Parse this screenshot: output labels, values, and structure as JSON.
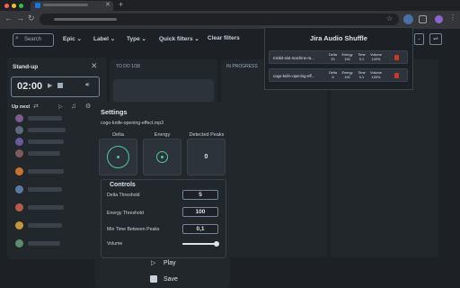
{
  "browser": {
    "new_tab_symbol": "+"
  },
  "toolbar": {
    "search_placeholder": "Search",
    "filters": [
      "Epic",
      "Label",
      "Type",
      "Quick filters"
    ],
    "clear_filters": "Clear filters"
  },
  "board": {
    "columns": [
      "TO DO 1/38",
      "IN PROGRESS"
    ]
  },
  "standup": {
    "title": "Stand-up",
    "timer": "02:00",
    "up_next": "Up next"
  },
  "popup": {
    "title": "Jira Audio Shuffle",
    "columns": [
      "Delta",
      "Energy",
      "Time",
      "Volume"
    ],
    "rows": [
      {
        "name": "minkit-slot-machine-ra...",
        "delta": "20",
        "energy": "100",
        "time": "0.1",
        "volume": "100%"
      },
      {
        "name": "cogo-knife-opening-eff...",
        "delta": "5",
        "energy": "100",
        "time": "0.1",
        "volume": "100%"
      }
    ]
  },
  "settings": {
    "title": "Settings",
    "filename": "cogo-knife-opening-effect.mp3",
    "visuals": {
      "delta": "Delta",
      "energy": "Energy",
      "peaks": "Detected Peaks",
      "peaks_value": "0"
    },
    "controls_title": "Controls",
    "controls": [
      {
        "label": "Delta Threshold",
        "value": "5"
      },
      {
        "label": "Energy Threshold",
        "value": "100"
      },
      {
        "label": "Min Time Between Peaks",
        "value": "0,1"
      }
    ],
    "volume_label": "Volume",
    "volume_level": 0.95,
    "play": "Play",
    "save": "Save"
  },
  "colors": {
    "accent": "#4bce97",
    "delete": "#c9372c"
  }
}
